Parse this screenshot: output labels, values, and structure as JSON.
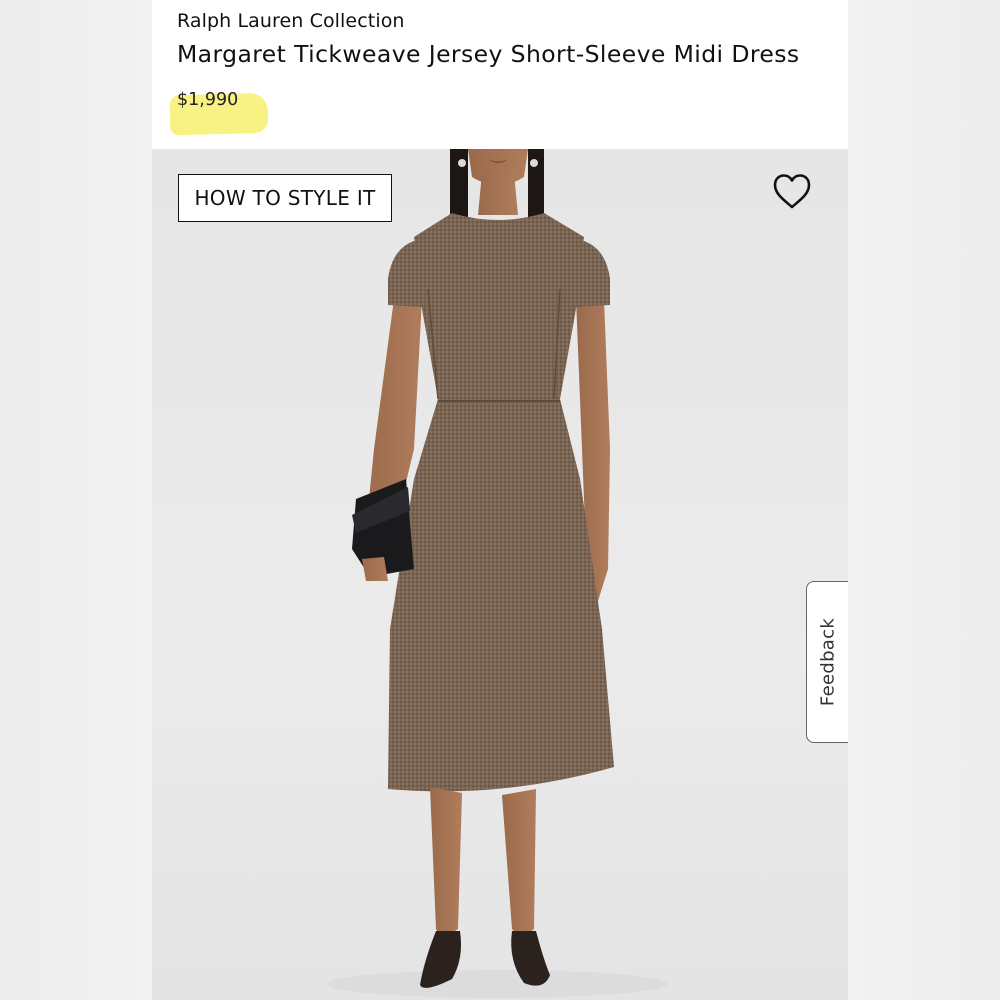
{
  "product": {
    "brand": "Ralph Lauren Collection",
    "title": "Margaret Tickweave Jersey Short-Sleeve Midi Dress",
    "price": "$1,990"
  },
  "photo": {
    "style_button_label": "HOW TO STYLE IT",
    "favorite_icon": "heart-icon"
  },
  "feedback_tab": {
    "label": "Feedback"
  },
  "colors": {
    "price_highlight": "#f7ef6f",
    "dress": "#7a6453",
    "background": "#e9e9e9"
  }
}
